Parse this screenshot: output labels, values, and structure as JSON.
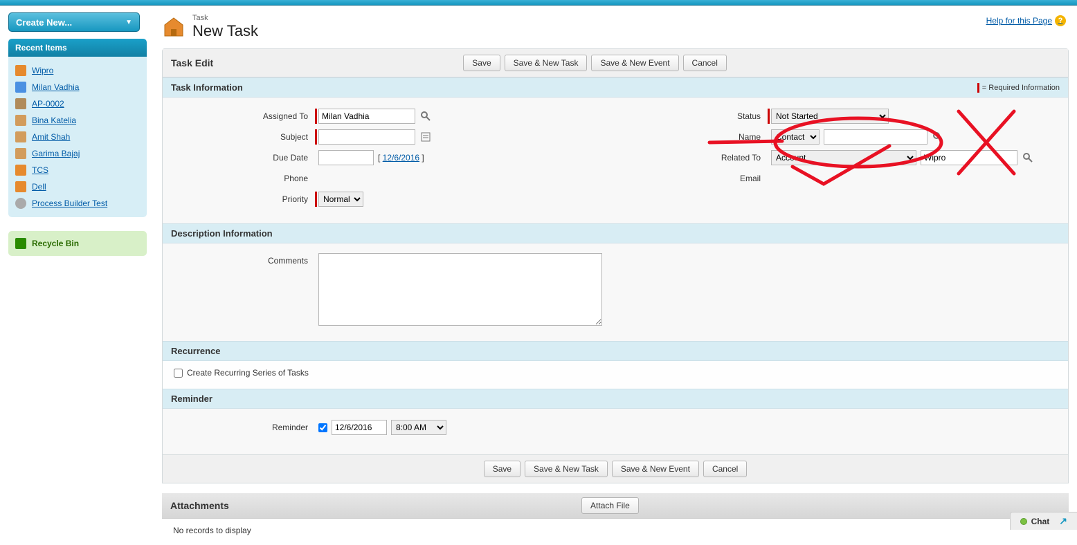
{
  "sidebar": {
    "create_new": "Create New...",
    "recent_head": "Recent Items",
    "recent": [
      {
        "icon": "ic-acct",
        "label": "Wipro"
      },
      {
        "icon": "ic-user",
        "label": "Milan Vadhia"
      },
      {
        "icon": "ic-doc",
        "label": "AP-0002"
      },
      {
        "icon": "ic-head",
        "label": "Bina Katelia"
      },
      {
        "icon": "ic-head",
        "label": "Amit Shah"
      },
      {
        "icon": "ic-head",
        "label": "Garima Bajaj"
      },
      {
        "icon": "ic-acct",
        "label": "TCS"
      },
      {
        "icon": "ic-acct",
        "label": "Dell"
      },
      {
        "icon": "ic-proc",
        "label": "Process Builder Test"
      }
    ],
    "recycle": "Recycle Bin"
  },
  "header": {
    "crumb": "Task",
    "title": "New Task",
    "help": "Help for this Page"
  },
  "buttons": {
    "save": "Save",
    "save_new_task": "Save & New Task",
    "save_new_event": "Save & New Event",
    "cancel": "Cancel",
    "attach_file": "Attach File"
  },
  "panel": {
    "task_edit": "Task Edit",
    "task_info": "Task Information",
    "desc_info": "Description Information",
    "recurrence": "Recurrence",
    "reminder": "Reminder",
    "attachments": "Attachments",
    "required_note": "= Required Information",
    "no_records": "No records to display"
  },
  "labels": {
    "assigned_to": "Assigned To",
    "subject": "Subject",
    "due_date": "Due Date",
    "phone": "Phone",
    "priority": "Priority",
    "status": "Status",
    "name": "Name",
    "related_to": "Related To",
    "email": "Email",
    "comments": "Comments",
    "reminder": "Reminder",
    "create_recurring": "Create Recurring Series of Tasks"
  },
  "values": {
    "assigned_to": "Milan Vadhia",
    "subject": "",
    "due_date": "",
    "today_link": "12/6/2016",
    "priority": "Normal",
    "status": "Not Started",
    "name_type": "Contact",
    "name_value": "",
    "related_to_type": "Account",
    "related_to_value": "Wipro",
    "comments": "",
    "reminder_checked": true,
    "reminder_date": "12/6/2016",
    "reminder_time": "8:00 AM"
  },
  "chat": {
    "label": "Chat"
  }
}
